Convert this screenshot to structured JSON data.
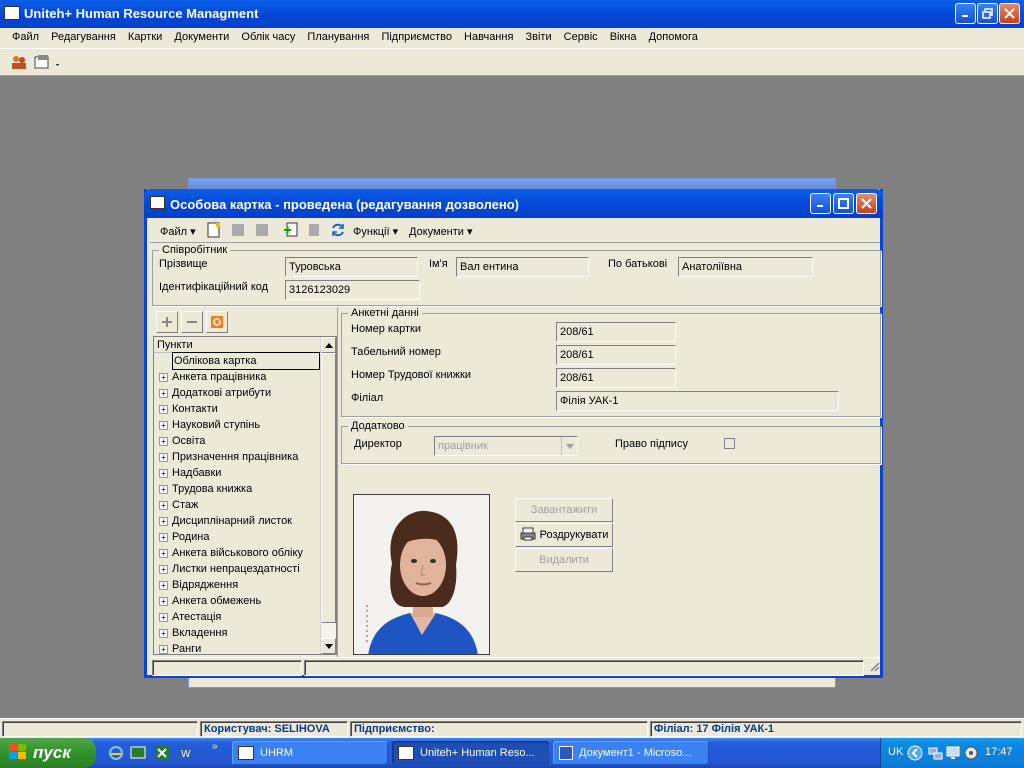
{
  "app": {
    "title": "Uniteh+ Human Resource Managment",
    "menu": [
      "Файл",
      "Редагування",
      "Картки",
      "Документи",
      "Облік часу",
      "Планування",
      "Підприємство",
      "Навчання",
      "Звіти",
      "Сервіс",
      "Вікна",
      "Допомога"
    ]
  },
  "dialog": {
    "title": "Особова картка - проведена (редагування дозволено)",
    "toolbar": {
      "file": "Файл",
      "functions": "Функції",
      "documents": "Документи"
    },
    "employee": {
      "group": "Співробітник",
      "surname_label": "Прізвище",
      "surname": "Туровська",
      "name_label": "Ім'я",
      "name": "Вал ентина",
      "patronymic_label": "По батькові",
      "patronymic": "Анатоліївна",
      "id_label": "Ідентифікаційний код",
      "id": "3126123029"
    },
    "tree": {
      "header": "Пункти",
      "items": [
        "Облікова картка",
        "Анкета працівника",
        "Додаткові атрибути",
        "Контакти",
        "Науковий ступінь",
        "Освіта",
        "Призначення працівника",
        "Надбавки",
        "Трудова книжка",
        "Стаж",
        "Дисциплінарний листок",
        "Родина",
        "Анкета військового обліку",
        "Листки непрацездатності",
        "Відрядження",
        "Анкета обмежень",
        "Атестація",
        "Вкладення",
        "Ранги"
      ]
    },
    "personal": {
      "group": "Анкетні данні",
      "card_label": "Номер картки",
      "card": "208/61",
      "tab_label": "Табельний номер",
      "tab": "208/61",
      "book_label": "Номер Трудової книжки",
      "book": "208/61",
      "branch_label": "Філіал",
      "branch": "Філія УАК-1"
    },
    "extra": {
      "group": "Додатково",
      "director_label": "Директор",
      "director": "працівник",
      "sign_label": "Право підпису"
    },
    "photo_buttons": {
      "load": "Завантажити",
      "print": "Роздрукувати",
      "delete": "Видалити"
    }
  },
  "statusbar": {
    "user": "Користувач: SELIHOVA",
    "company": "Підприємство:",
    "branch": "Філіал: 17 Філія УАК-1"
  },
  "taskbar": {
    "start": "пуск",
    "tasks": [
      "UHRM",
      "Uniteh+ Human Reso...",
      "Документ1 - Microso..."
    ],
    "lang": "UK",
    "time": "17:47"
  }
}
